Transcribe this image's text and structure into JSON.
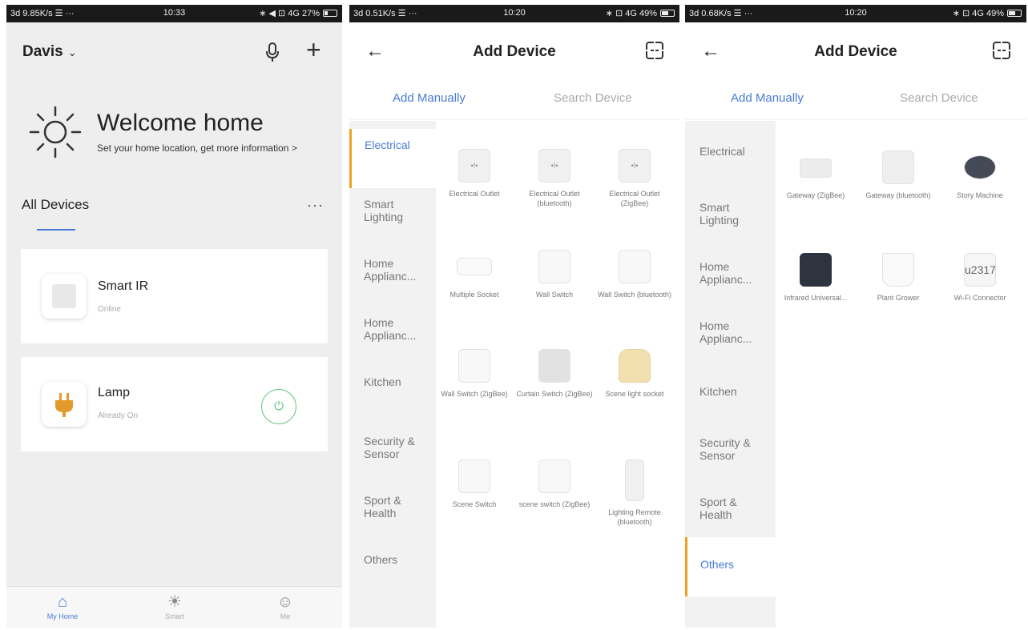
{
  "screen1": {
    "status": {
      "left": "3d 9.85K/s ☰ ···",
      "time": "10:33",
      "right": "∗ ◀ ⊡ 4G 27%"
    },
    "home_name": "Davis",
    "welcome_title": "Welcome home",
    "welcome_sub": "Set your home location, get more information",
    "all_devices": "All Devices",
    "devices": [
      {
        "name": "Smart IR",
        "status": "Online"
      },
      {
        "name": "Lamp",
        "status": "Already On"
      }
    ],
    "nav": [
      "My Home",
      "Smart",
      "Me"
    ]
  },
  "screen2": {
    "status": {
      "left": "3d 0.51K/s ☰ ···",
      "time": "10:20",
      "right": "∗ ⊡ 4G 49%"
    },
    "title": "Add Device",
    "tabs": [
      "Add Manually",
      "Search Device"
    ],
    "categories": [
      "Electrical",
      "Smart Lighting",
      "Home Applianc...",
      "Home Applianc...",
      "Kitchen",
      "Security & Sensor",
      "Sport & Health",
      "Others"
    ],
    "devices": [
      {
        "label": "Electrical Outlet"
      },
      {
        "label": "Electrical Outlet (bluetooth)"
      },
      {
        "label": "Electrical Outlet (ZigBee)"
      },
      {
        "label": "Multiple Socket"
      },
      {
        "label": "Wall Switch"
      },
      {
        "label": "Wall Switch (bluetooth)"
      },
      {
        "label": "Wall Switch (ZigBee)"
      },
      {
        "label": "Curtain Switch (ZigBee)"
      },
      {
        "label": "Scene light socket"
      },
      {
        "label": "Scene Switch"
      },
      {
        "label": "scene switch (ZigBee)"
      },
      {
        "label": "Lighting Remote (bluetooth)"
      }
    ]
  },
  "screen3": {
    "status": {
      "left": "3d 0.68K/s ☰ ···",
      "time": "10:20",
      "right": "∗ ⊡ 4G 49%"
    },
    "title": "Add Device",
    "tabs": [
      "Add Manually",
      "Search Device"
    ],
    "categories": [
      "Electrical",
      "Smart Lighting",
      "Home Applianc...",
      "Home Applianc...",
      "Kitchen",
      "Security & Sensor",
      "Sport & Health",
      "Others"
    ],
    "devices": [
      {
        "label": "Gateway (ZigBee)"
      },
      {
        "label": "Gateway (bluetooth)"
      },
      {
        "label": "Story Machine"
      },
      {
        "label": "Infrared Universal..."
      },
      {
        "label": "Plant Grower"
      },
      {
        "label": "Wi-Fi Connector"
      }
    ]
  }
}
